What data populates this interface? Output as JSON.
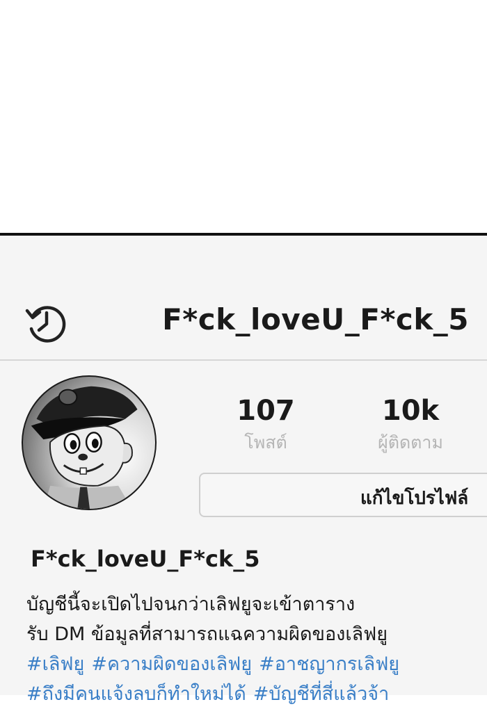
{
  "header": {
    "title": "F*ck_loveU_F*ck_5",
    "history_icon": "history-icon"
  },
  "stats": {
    "posts_value": "107",
    "posts_label": "โพสต์",
    "followers_value": "10k",
    "followers_label": "ผู้ติดตาม"
  },
  "edit_profile_label": "แก้ไขโปรไฟล์",
  "profile": {
    "name": "F*ck_loveU_F*ck_5",
    "bio_line_1": "บัญชีนี้จะเปิดไปจนกว่าเลิฟยูจะเข้าตาราง",
    "bio_line_2": "รับ DM ข้อมูลที่สามารถแฉความผิดของเลิฟยู",
    "hashtags_row_1": [
      "#เลิฟยู",
      "#ความผิดของเลิฟยู",
      "#อาชญากรเลิฟยู"
    ],
    "hashtags_row_2": [
      "#ถึงมีคนแจ้งลบก็ทำใหม่ได้",
      "#บัญชีที่สี่แล้วจ้า"
    ]
  },
  "colors": {
    "hashtag": "#3a7fc7",
    "label_gray": "#b5b5b5",
    "background": "#f5f5f5"
  }
}
